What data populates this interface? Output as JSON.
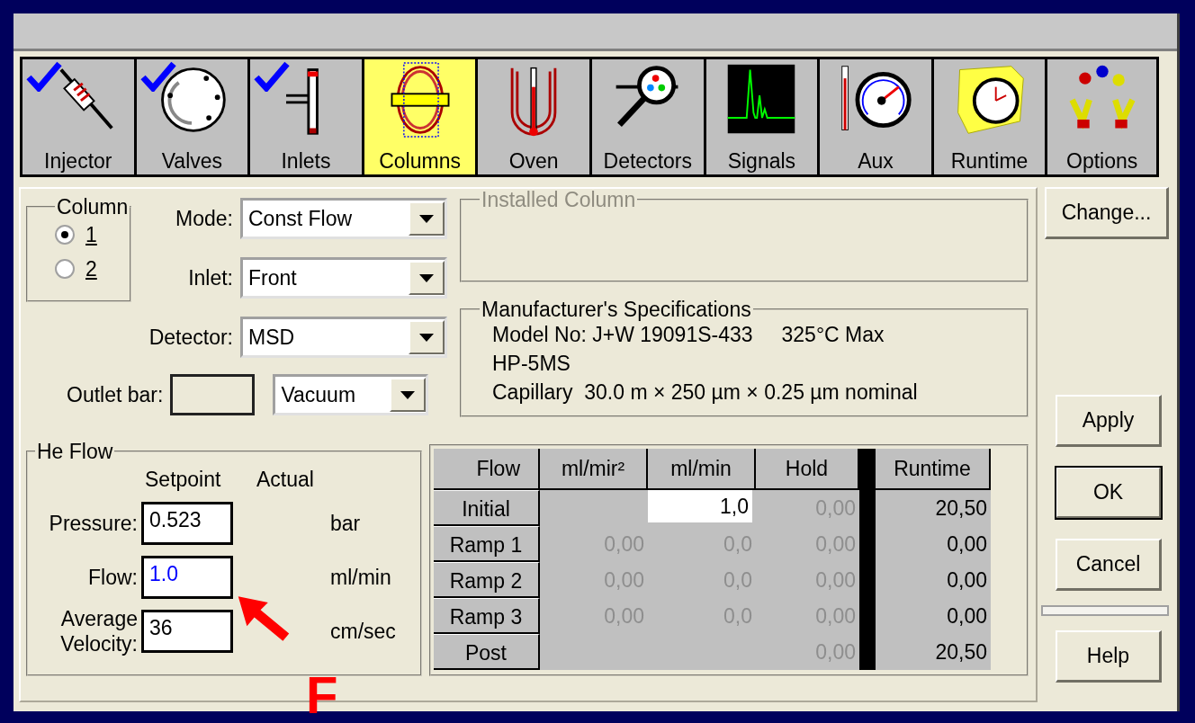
{
  "tools": [
    {
      "label": "Injector",
      "selected": false,
      "checked": true
    },
    {
      "label": "Valves",
      "selected": false,
      "checked": true
    },
    {
      "label": "Inlets",
      "selected": false,
      "checked": true
    },
    {
      "label": "Columns",
      "selected": true,
      "checked": false
    },
    {
      "label": "Oven",
      "selected": false,
      "checked": false
    },
    {
      "label": "Detectors",
      "selected": false,
      "checked": false
    },
    {
      "label": "Signals",
      "selected": false,
      "checked": false
    },
    {
      "label": "Aux",
      "selected": false,
      "checked": false
    },
    {
      "label": "Runtime",
      "selected": false,
      "checked": false
    },
    {
      "label": "Options",
      "selected": false,
      "checked": false
    }
  ],
  "column_group": {
    "title": "Column",
    "options": [
      {
        "label": "1",
        "selected": true
      },
      {
        "label": "2",
        "selected": false
      }
    ]
  },
  "combos": [
    {
      "label": "Mode:",
      "value": "Const Flow"
    },
    {
      "label": "Inlet:",
      "value": "Front"
    },
    {
      "label": "Detector:",
      "value": "MSD"
    }
  ],
  "outlet": {
    "label": "Outlet bar:",
    "combo_value": "Vacuum"
  },
  "installed_column": {
    "title": "Installed Column",
    "disabled": true
  },
  "specifications": {
    "title": "Manufacturer's Specifications",
    "lines": [
      "Model No: J+W 19091S-433     325°C Max",
      "HP-5MS",
      "Capillary  30.0 m × 250 µm × 0.25 µm nominal"
    ]
  },
  "he_flow": {
    "title": "He Flow",
    "headers": [
      "Setpoint",
      "Actual"
    ],
    "fields": [
      {
        "label": "Pressure:",
        "value": "0.523",
        "unit": "bar",
        "highlight": false
      },
      {
        "label": "Flow:",
        "value": "1.0",
        "unit": "ml/min",
        "highlight": true
      },
      {
        "label": "Average Velocity:",
        "value": "36",
        "unit": "cm/sec",
        "highlight": false
      }
    ]
  },
  "flow_table": {
    "columns": [
      "Flow",
      "ml/mir²",
      "ml/min",
      "Hold",
      "Runtime"
    ],
    "rows": [
      {
        "label": "Initial",
        "cells": [
          {
            "kind": "blank"
          },
          {
            "kind": "edit",
            "value": "1,0"
          },
          {
            "kind": "disabled",
            "value": "0,00"
          },
          {
            "kind": "value",
            "value": "20,50"
          }
        ]
      },
      {
        "label": "Ramp 1",
        "cells": [
          {
            "kind": "disabled",
            "value": "0,00"
          },
          {
            "kind": "disabled",
            "value": "0,0"
          },
          {
            "kind": "disabled",
            "value": "0,00"
          },
          {
            "kind": "value",
            "value": "0,00"
          }
        ]
      },
      {
        "label": "Ramp 2",
        "cells": [
          {
            "kind": "disabled",
            "value": "0,00"
          },
          {
            "kind": "disabled",
            "value": "0,0"
          },
          {
            "kind": "disabled",
            "value": "0,00"
          },
          {
            "kind": "value",
            "value": "0,00"
          }
        ]
      },
      {
        "label": "Ramp 3",
        "cells": [
          {
            "kind": "disabled",
            "value": "0,00"
          },
          {
            "kind": "disabled",
            "value": "0,0"
          },
          {
            "kind": "disabled",
            "value": "0,00"
          },
          {
            "kind": "value",
            "value": "0,00"
          }
        ]
      },
      {
        "label": "Post",
        "cells": [
          {
            "kind": "blank"
          },
          {
            "kind": "blank"
          },
          {
            "kind": "disabled",
            "value": "0,00"
          },
          {
            "kind": "value",
            "value": "20,50"
          }
        ]
      }
    ]
  },
  "buttons": [
    {
      "label": "Change...",
      "kind": "top",
      "default": false
    },
    {
      "label": "Apply",
      "kind": "bottom",
      "default": false
    },
    {
      "label": "OK",
      "kind": "bottom",
      "default": true
    },
    {
      "label": "Cancel",
      "kind": "bottom",
      "default": false
    },
    {
      "label": "Help",
      "kind": "help",
      "default": false
    }
  ],
  "annotation": {
    "label": "F"
  }
}
